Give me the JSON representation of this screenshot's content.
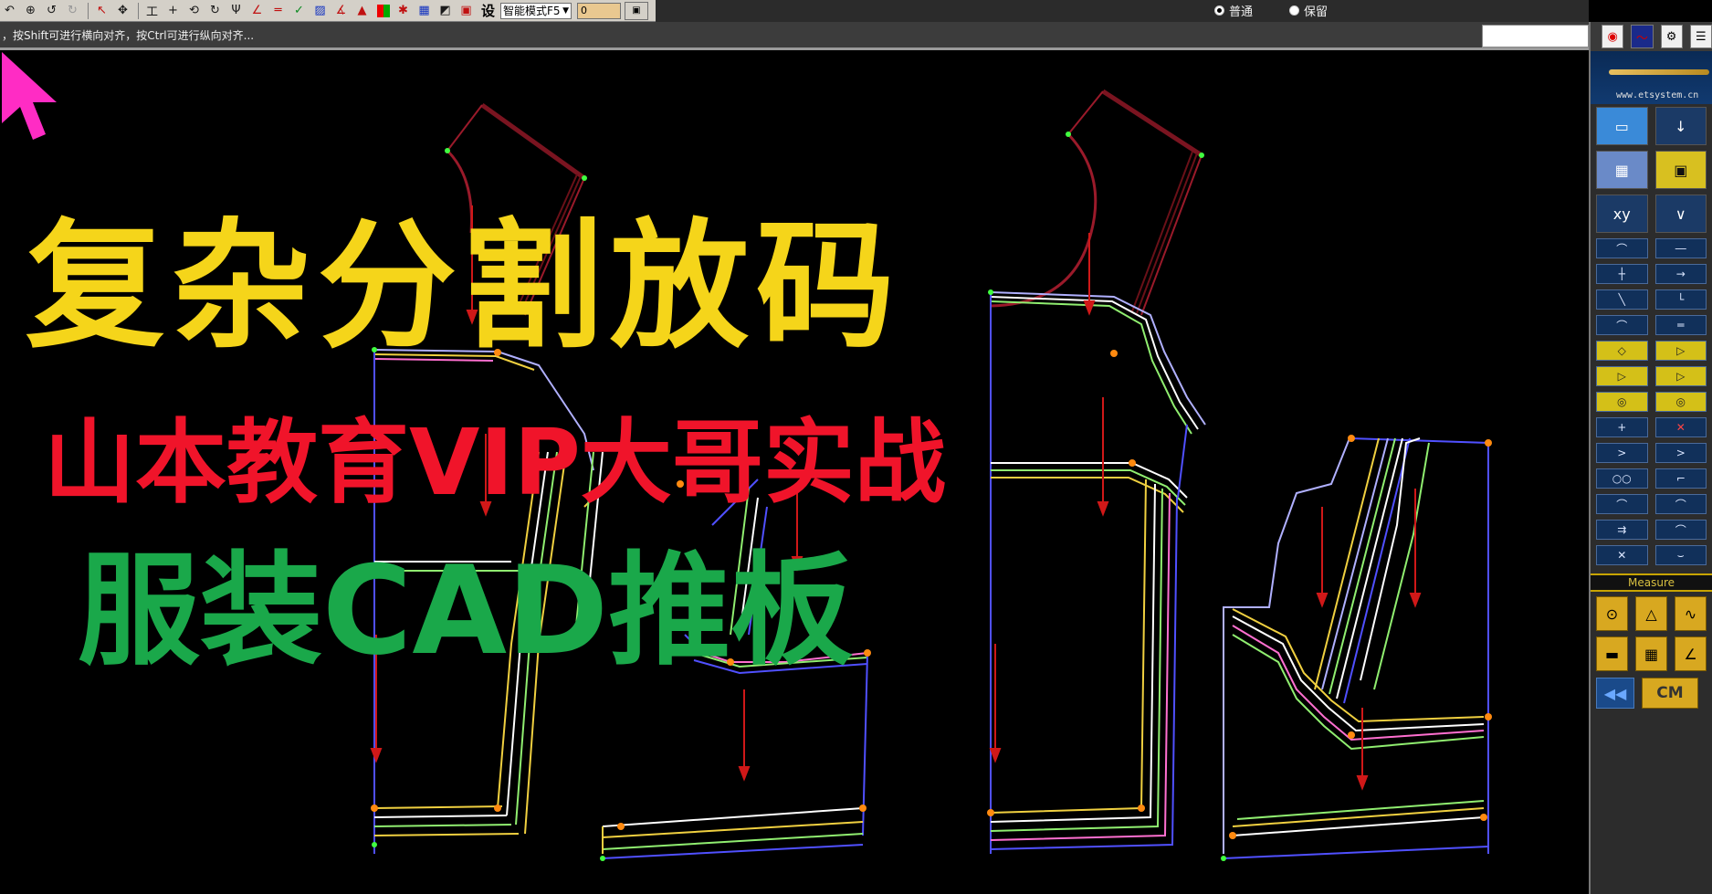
{
  "toolbar": {
    "icons": [
      "undo-cursor-icon",
      "zoom-icon",
      "undo-icon",
      "redo-icon",
      "select-icon",
      "move-icon",
      "align-icon",
      "add-point-icon",
      "rotate-icon",
      "mirror-icon",
      "fork-icon",
      "angle-icon",
      "line-icon",
      "check-icon",
      "hatch-icon",
      "measure-icon",
      "mountain-icon",
      "color-icon",
      "cross-icon",
      "grid-icon",
      "fill-icon",
      "snapshot-icon"
    ],
    "settings_label": "设",
    "mode_select_value": "智能模式F5",
    "number_value": "0",
    "radio_normal": "普通",
    "radio_keep": "保留",
    "radio_selected": "normal"
  },
  "hint": {
    "text": "，按Shift可进行横向对齐，按Ctrl可进行纵向对齐..."
  },
  "overlay": {
    "title": "复杂分割放码",
    "subtitle": "山本教育VIP大哥实战",
    "subtitle2": "服装CAD推板"
  },
  "right_panel": {
    "website": "www.etsystem.cn",
    "measure_label": "Measure",
    "unit_label": "CM",
    "unit_prev": "◀◀"
  },
  "colors": {
    "title_yellow": "#f5d51a",
    "subtitle_red": "#f0142a",
    "subtitle_green": "#1aa84a",
    "cursor_pink": "#ff2cc4",
    "canvas_bg": "#000000"
  }
}
